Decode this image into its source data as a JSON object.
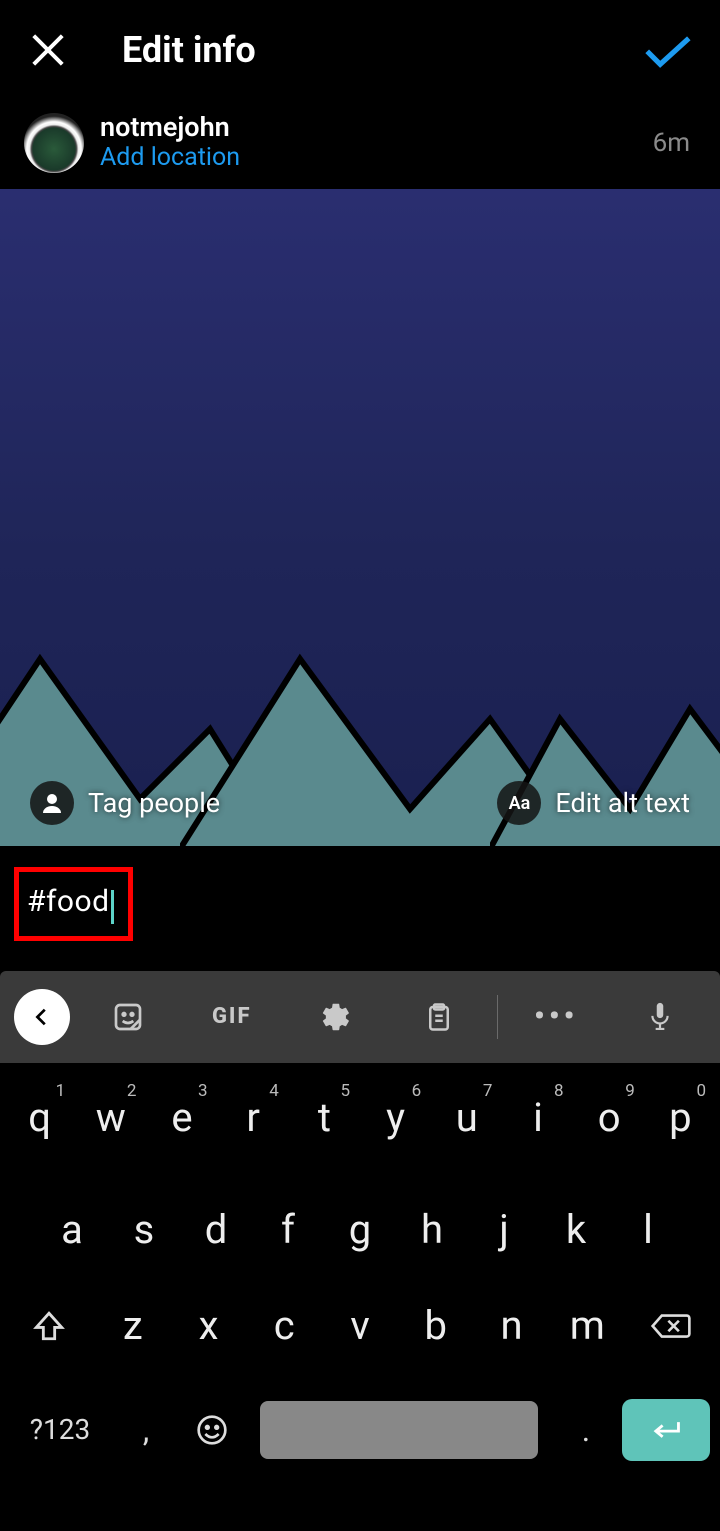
{
  "header": {
    "title": "Edit info"
  },
  "user": {
    "name": "notmejohn",
    "location_cta": "Add location",
    "time": "6m"
  },
  "image_overlay": {
    "tag_label": "Tag people",
    "alt_label": "Edit alt text",
    "alt_icon_text": "Aa"
  },
  "caption": {
    "text": "#food"
  },
  "toolbar": {
    "gif": "GIF"
  },
  "keyboard": {
    "row1": [
      {
        "k": "q",
        "n": "1"
      },
      {
        "k": "w",
        "n": "2"
      },
      {
        "k": "e",
        "n": "3"
      },
      {
        "k": "r",
        "n": "4"
      },
      {
        "k": "t",
        "n": "5"
      },
      {
        "k": "y",
        "n": "6"
      },
      {
        "k": "u",
        "n": "7"
      },
      {
        "k": "i",
        "n": "8"
      },
      {
        "k": "o",
        "n": "9"
      },
      {
        "k": "p",
        "n": "0"
      }
    ],
    "row2": [
      "a",
      "s",
      "d",
      "f",
      "g",
      "h",
      "j",
      "k",
      "l"
    ],
    "row3": [
      "z",
      "x",
      "c",
      "v",
      "b",
      "n",
      "m"
    ],
    "sym": "?123",
    "comma": ",",
    "dot": "."
  }
}
